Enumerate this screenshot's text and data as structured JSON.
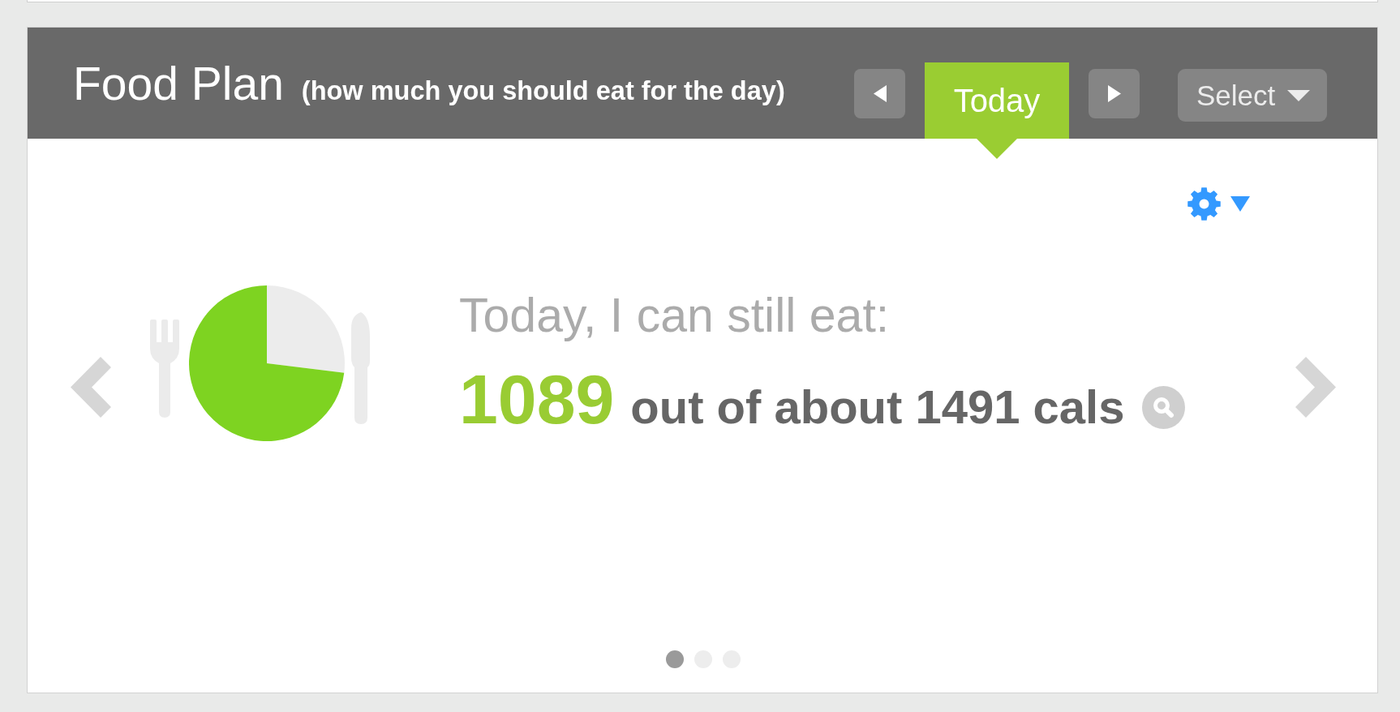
{
  "food_plan": {
    "title": "Food Plan",
    "subtitle": "(how much you should eat for the day)",
    "nav": {
      "day_tab": {
        "label": "Today",
        "selected": true
      },
      "select": {
        "label": "Select"
      }
    },
    "summary": {
      "prompt": "Today, I can still eat:",
      "remaining": "1089",
      "detail": "out of about 1491 cals"
    },
    "carousel": {
      "pages": [
        {
          "selected": true
        },
        {
          "selected": false
        },
        {
          "selected": false
        }
      ]
    }
  }
}
